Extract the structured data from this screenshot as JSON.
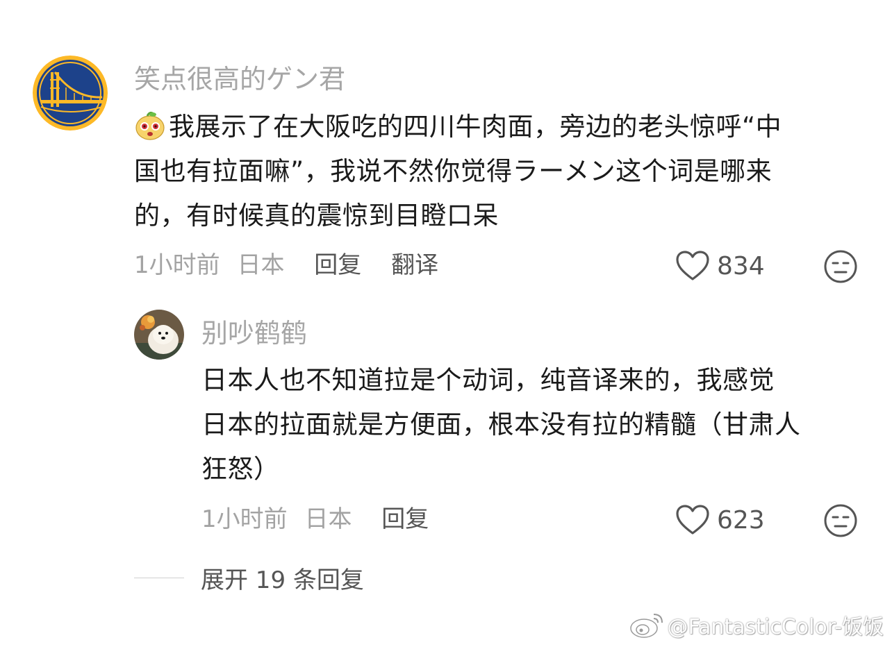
{
  "comment": {
    "username": "笑点很高的ゲン君",
    "emoji_icon": "cute-creature-emoji-icon",
    "text_lines": [
      "我展示了在大阪吃的四川牛肉面，旁边的老头惊呼“中",
      "国也有拉面嘛”，我说不然你觉得ラーメン这个词是哪来",
      "的，有时候真的震惊到目瞪口呆"
    ],
    "time": "1小时前",
    "location": "日本",
    "reply_label": "回复",
    "translate_label": "翻译",
    "like_count": "834"
  },
  "reply": {
    "username": "别吵鹤鹤",
    "text_lines": [
      "日本人也不知道拉是个动词，纯音译来的，我感觉",
      "日本的拉面就是方便面，根本没有拉的精髓（甘肃人",
      "狂怒）"
    ],
    "time": "1小时前",
    "location": "日本",
    "reply_label": "回复",
    "like_count": "623"
  },
  "expand_replies": "展开 19 条回复",
  "watermark": "@FantasticColor-饭饭",
  "colors": {
    "avatar_blue": "#1d428a",
    "avatar_gold": "#fdb927",
    "muted_text": "#a3a3a3",
    "body_text": "#1a1a1a",
    "action_text": "#555555"
  }
}
